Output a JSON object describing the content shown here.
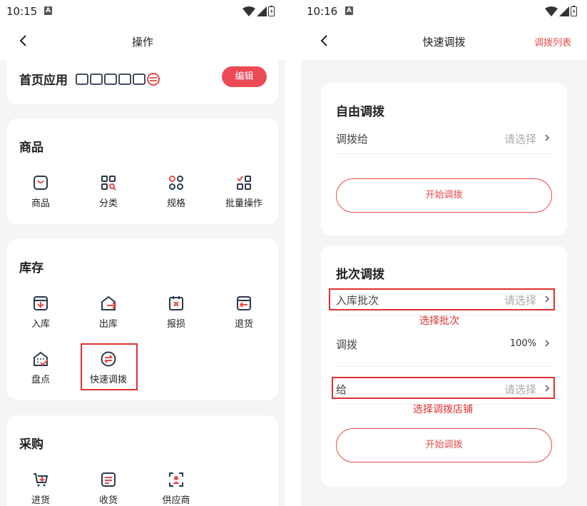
{
  "left": {
    "status_time": "10:15",
    "status_badge": "A",
    "nav_title": "操作",
    "home_apps": {
      "title": "首页应用",
      "edit_label": "编辑"
    },
    "goods": {
      "title": "商品",
      "items": [
        {
          "label": "商品",
          "icon": "bag-icon"
        },
        {
          "label": "分类",
          "icon": "category-grid-icon"
        },
        {
          "label": "规格",
          "icon": "spec-grid-icon"
        },
        {
          "label": "批量操作",
          "icon": "batch-icon"
        }
      ]
    },
    "inventory": {
      "title": "库存",
      "items": [
        {
          "label": "入库",
          "icon": "inbound-icon"
        },
        {
          "label": "出库",
          "icon": "outbound-icon"
        },
        {
          "label": "报损",
          "icon": "damage-icon"
        },
        {
          "label": "退货",
          "icon": "return-icon"
        },
        {
          "label": "盘点",
          "icon": "stocktake-icon"
        },
        {
          "label": "快速调拨",
          "icon": "quick-transfer-icon"
        }
      ]
    },
    "purchase": {
      "title": "采购",
      "items": [
        {
          "label": "进货",
          "icon": "cart-icon"
        },
        {
          "label": "收货",
          "icon": "receive-icon"
        },
        {
          "label": "供应商",
          "icon": "supplier-icon"
        }
      ]
    }
  },
  "right": {
    "status_time": "10:16",
    "status_badge": "A",
    "nav_title": "快速调拨",
    "nav_action": "调拨列表",
    "free_transfer": {
      "title": "自由调拨",
      "row_label": "调拨给",
      "row_value": "请选择",
      "button": "开始调拨"
    },
    "batch_transfer": {
      "title": "批次调拨",
      "rows": [
        {
          "label": "入库批次",
          "value": "请选择"
        },
        {
          "label": "调拨",
          "value": "100%"
        },
        {
          "label": "给",
          "value": "请选择"
        }
      ],
      "button": "开始调拨"
    },
    "annotations": {
      "select_batch": "选择批次",
      "select_store": "选择调拨店铺"
    }
  },
  "colors": {
    "accent": "#e94a4a",
    "button": "#ec4a55",
    "icon": "#2b3a4a",
    "annotation": "#e03131"
  }
}
